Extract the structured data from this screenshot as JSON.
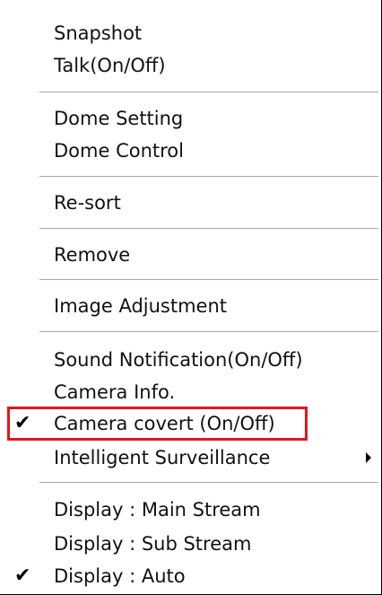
{
  "menu": {
    "items": [
      {
        "label": "Snapshot"
      },
      {
        "label": "Talk(On/Off)"
      },
      {
        "label": "Dome Setting"
      },
      {
        "label": "Dome Control"
      },
      {
        "label": "Re-sort"
      },
      {
        "label": "Remove"
      },
      {
        "label": "Image Adjustment"
      },
      {
        "label": "Sound Notification(On/Off)"
      },
      {
        "label": "Camera Info."
      },
      {
        "label": "Camera covert (On/Off)",
        "checked": true,
        "highlighted": true,
        "highlight_color": "#e01818"
      },
      {
        "label": "Intelligent Surveillance",
        "has_submenu": true
      },
      {
        "label": "Display : Main Stream"
      },
      {
        "label": "Display : Sub Stream"
      },
      {
        "label": "Display : Auto",
        "checked": true
      }
    ],
    "check_glyph": "✔"
  }
}
